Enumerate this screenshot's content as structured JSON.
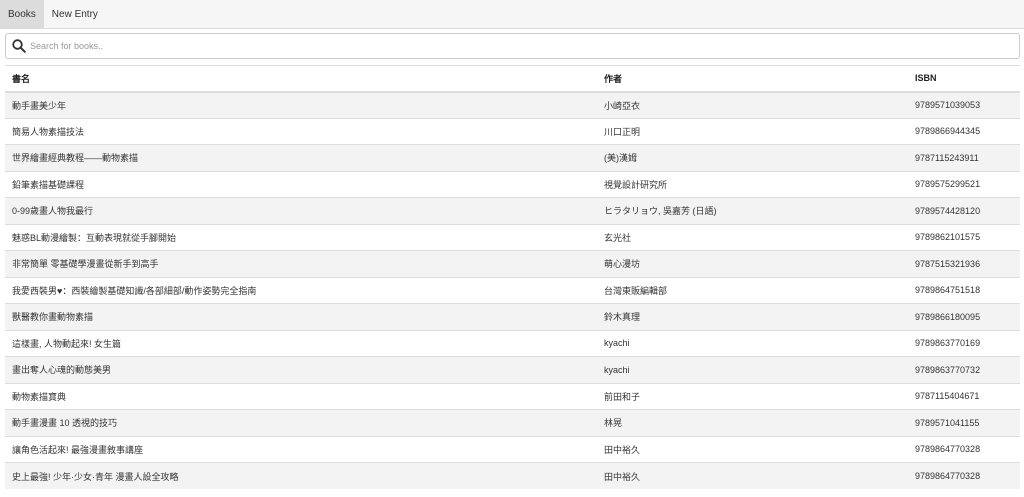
{
  "nav": {
    "tabs": [
      {
        "label": "Books",
        "active": true
      },
      {
        "label": "New Entry",
        "active": false
      }
    ]
  },
  "search": {
    "placeholder": "Search for books..",
    "value": "",
    "icon": "search-icon"
  },
  "table": {
    "columns": [
      "書名",
      "作者",
      "ISBN"
    ],
    "rows": [
      {
        "title": "動手畫美少年",
        "author": "小崎亞衣",
        "isbn": "9789571039053"
      },
      {
        "title": "簡易人物素描技法",
        "author": "川口正明",
        "isbn": "9789866944345"
      },
      {
        "title": "世界繪畫經典教程——動物素描",
        "author": "(美)漢姆",
        "isbn": "9787115243911"
      },
      {
        "title": "鉛筆素描基礎課程",
        "author": "視覺設計研究所",
        "isbn": "9789575299521"
      },
      {
        "title": "0-99歲畫人物我最行",
        "author": "ヒラタリョウ, 吳嘉芳 (日語)",
        "isbn": "9789574428120"
      },
      {
        "title": "魅惑BL動漫繪製：互動表現就從手腳開始",
        "author": "玄光社",
        "isbn": "9789862101575"
      },
      {
        "title": "非常簡單 零基礎學漫畫從新手到高手",
        "author": "萌心漫坊",
        "isbn": "9787515321936"
      },
      {
        "title": "我愛西裝男♥：西裝繪製基礎知識/各部細部/動作姿勢完全指南",
        "author": "台灣東販編輯部",
        "isbn": "9789864751518"
      },
      {
        "title": "獸醫教你畫動物素描",
        "author": "鈴木真理",
        "isbn": "9789866180095"
      },
      {
        "title": "這樣畫, 人物動起來! 女生篇",
        "author": "kyachi",
        "isbn": "9789863770169"
      },
      {
        "title": "畫出奪人心魂的動態美男",
        "author": "kyachi",
        "isbn": "9789863770732"
      },
      {
        "title": "動物素描寶典",
        "author": "前田和子",
        "isbn": "9787115404671"
      },
      {
        "title": "動手畫漫畫 10 透視的技巧",
        "author": "林晃",
        "isbn": "9789571041155"
      },
      {
        "title": "讓角色活起來! 最強漫畫敘事講座",
        "author": "田中裕久",
        "isbn": "9789864770328"
      },
      {
        "title": "史上最強! 少年·少女·青年 漫畫人設全攻略",
        "author": "田中裕久",
        "isbn": "9789864770328"
      }
    ]
  }
}
